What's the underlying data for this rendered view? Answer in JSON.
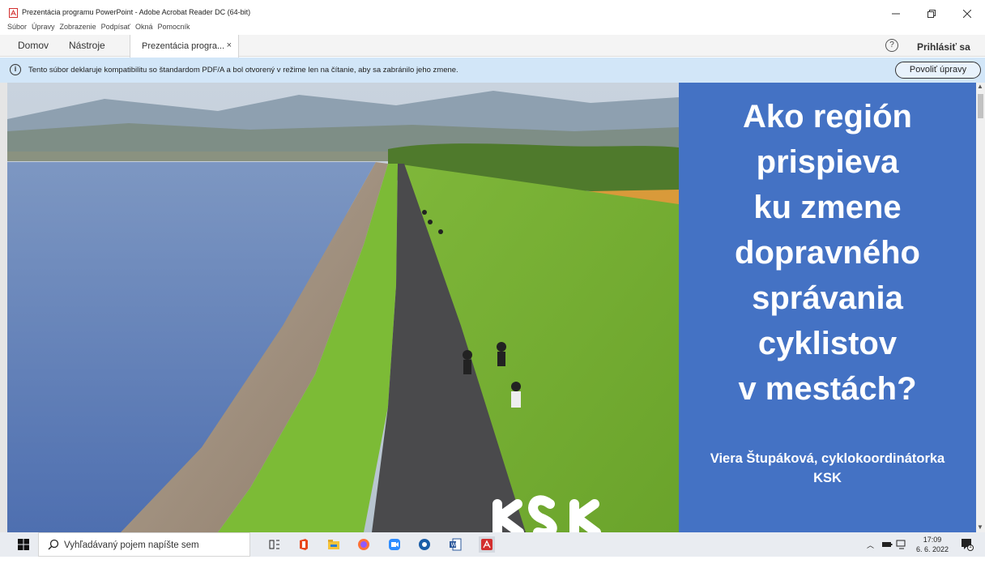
{
  "window": {
    "title": "Prezentácia programu PowerPoint - Adobe Acrobat Reader DC (64-bit)"
  },
  "menu": {
    "items": [
      "Súbor",
      "Úpravy",
      "Zobrazenie",
      "Podpísať",
      "Okná",
      "Pomocník"
    ]
  },
  "tabs": {
    "home": "Domov",
    "tools": "Nástroje",
    "document": "Prezentácia progra...",
    "close": "×",
    "help": "?",
    "signin": "Prihlásiť sa"
  },
  "infobar": {
    "icon": "i",
    "message": "Tento súbor deklaruje kompatibilitu so štandardom PDF/A a bol otvorený v režime len na čítanie, aby sa zabránilo jeho zmene.",
    "button": "Povoliť úpravy"
  },
  "slide": {
    "headline": [
      "Ako región",
      "prispieva",
      "ku zmene",
      "dopravného",
      "správania",
      "cyklistov",
      "v mestách?"
    ],
    "author_line1": "Viera Štupáková, cyklokoordinátorka",
    "author_line2": "KSK",
    "logo_text": "KSK",
    "panel_color": "#4472c4"
  },
  "taskbar": {
    "search_placeholder": "Vyhľadávaný pojem napíšte sem",
    "time": "17:09",
    "date": "6. 6. 2022",
    "notification_count": "1"
  }
}
